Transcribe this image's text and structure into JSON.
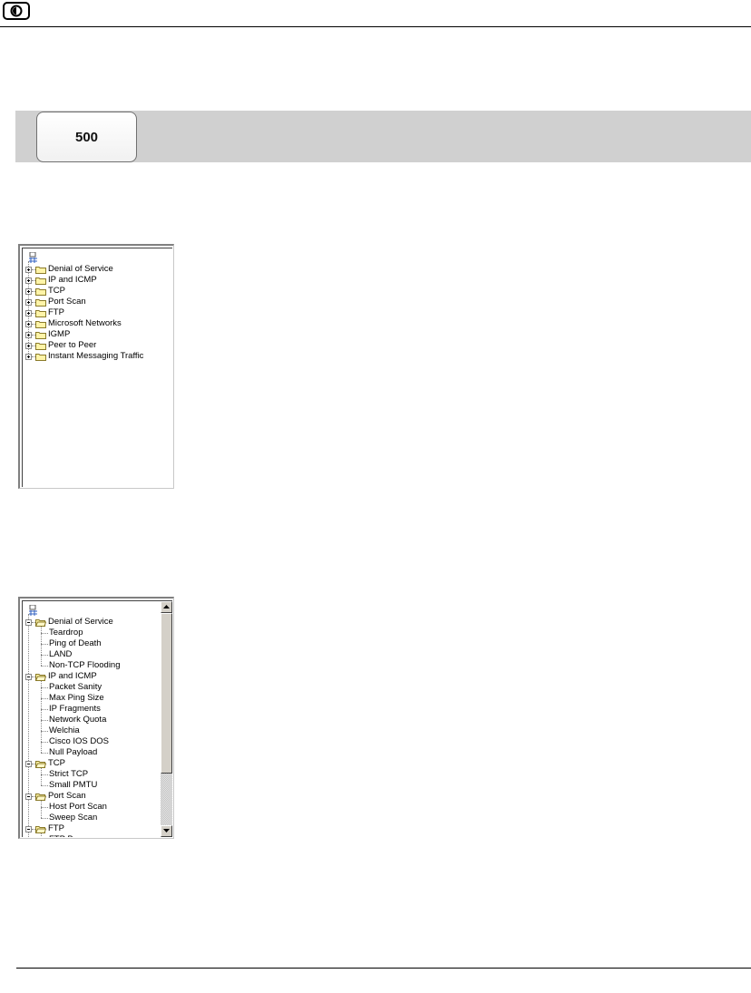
{
  "header": {
    "logo_icon": "circle-half-icon"
  },
  "banner": {
    "tab_label": "500",
    "background": "#d0d0d0"
  },
  "tree_collapsed": {
    "items": [
      "Denial of Service",
      "IP and ICMP",
      "TCP",
      "Port Scan",
      "FTP",
      "Microsoft Networks",
      "IGMP",
      "Peer to Peer",
      "Instant Messaging Traffic"
    ]
  },
  "tree_expanded": {
    "rows": [
      {
        "label": "Denial of Service",
        "level": 0
      },
      {
        "label": "Teardrop",
        "level": 1
      },
      {
        "label": "Ping of Death",
        "level": 1
      },
      {
        "label": "LAND",
        "level": 1
      },
      {
        "label": "Non-TCP Flooding",
        "level": 1
      },
      {
        "label": "IP and ICMP",
        "level": 0
      },
      {
        "label": "Packet Sanity",
        "level": 1
      },
      {
        "label": "Max Ping Size",
        "level": 1
      },
      {
        "label": "IP Fragments",
        "level": 1
      },
      {
        "label": "Network Quota",
        "level": 1
      },
      {
        "label": "Welchia",
        "level": 1
      },
      {
        "label": "Cisco IOS DOS",
        "level": 1
      },
      {
        "label": "Null Payload",
        "level": 1
      },
      {
        "label": "TCP",
        "level": 0
      },
      {
        "label": "Strict TCP",
        "level": 1
      },
      {
        "label": "Small PMTU",
        "level": 1
      },
      {
        "label": "Port Scan",
        "level": 0
      },
      {
        "label": "Host Port Scan",
        "level": 1
      },
      {
        "label": "Sweep Scan",
        "level": 1
      },
      {
        "label": "FTP",
        "level": 0
      },
      {
        "label": "FTP Bounce",
        "level": 1
      }
    ]
  },
  "colors": {
    "folder": "#fff4a8",
    "folder_border": "#8a7a2a",
    "selection_blue": "#3060c0"
  }
}
